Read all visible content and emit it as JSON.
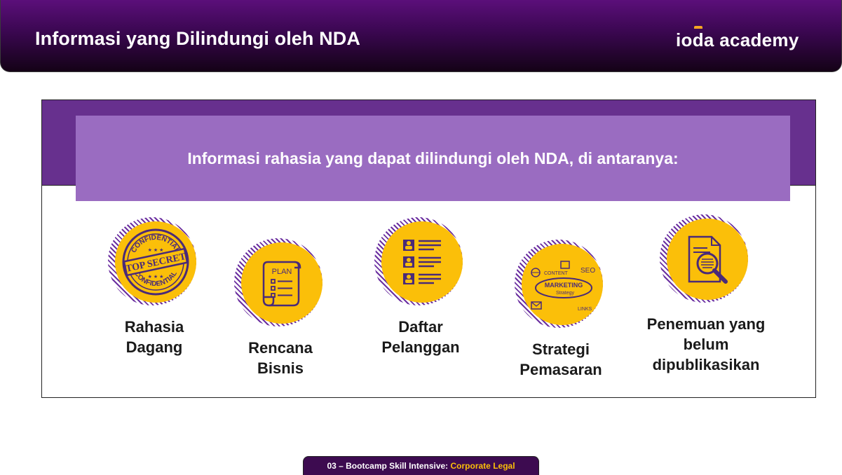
{
  "header": {
    "title": "Informasi yang Dilindungi oleh NDA",
    "logo_word1": "ioda",
    "logo_word2": "academy"
  },
  "banner": {
    "text": "Informasi rahasia yang dapat dilindungi oleh NDA, di antaranya:"
  },
  "items": [
    {
      "line1": "Rahasia",
      "line2": "Dagang",
      "line3": "",
      "icon": "top-secret-stamp-icon",
      "stamp_top": "CONFIDENTIAL",
      "stamp_mid": "TOP SECRET",
      "stamp_bottom": "CONFIDENTIAL"
    },
    {
      "line1": "Rencana",
      "line2": "Bisnis",
      "line3": "",
      "icon": "plan-scroll-icon",
      "scroll_text": "PLAN"
    },
    {
      "line1": "Daftar",
      "line2": "Pelanggan",
      "line3": "",
      "icon": "customer-list-icon"
    },
    {
      "line1": "Strategi",
      "line2": "Pemasaran",
      "line3": "",
      "icon": "marketing-strategy-icon",
      "doodle_content": "CONTENT",
      "doodle_seo": "SEO",
      "doodle_marketing": "MARKETING",
      "doodle_strategy": "Strategy",
      "doodle_links": "LINKS"
    },
    {
      "line1": "Penemuan yang",
      "line2": "belum",
      "line3": "dipublikasikan",
      "icon": "document-search-icon"
    }
  ],
  "footer": {
    "prefix": "03 – Bootcamp Skill Intensive: ",
    "accent": "Corporate Legal"
  },
  "colors": {
    "header_top": "#5b0f7a",
    "header_bottom": "#140216",
    "band": "#67308e",
    "banner": "#9a6cc1",
    "badge_yellow": "#fbbf09",
    "stripe_purple": "#6b2fa0",
    "icon_stroke": "#4a2a78",
    "footer_bg": "#3d0b50",
    "footer_accent": "#fbbf09"
  }
}
